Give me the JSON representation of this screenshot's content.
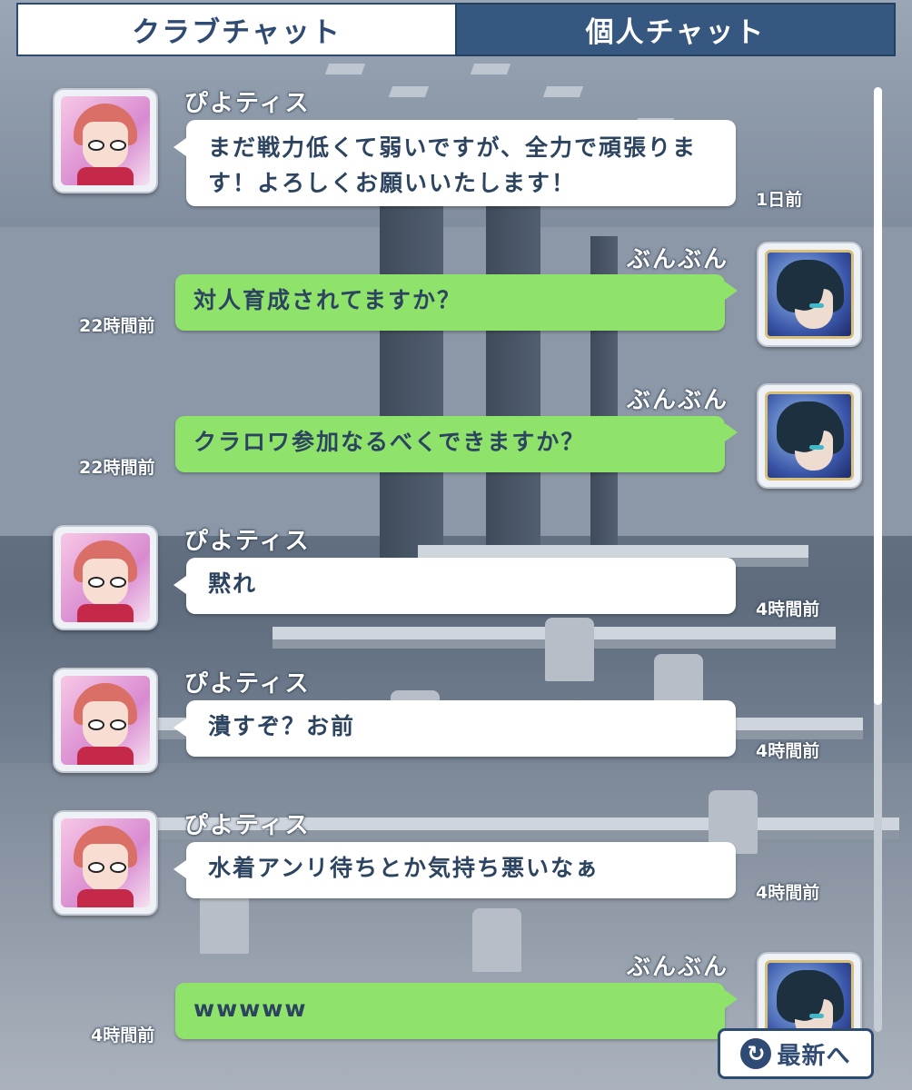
{
  "tabs": [
    {
      "label": "クラブチャット",
      "active": false
    },
    {
      "label": "個人チャット",
      "active": true
    }
  ],
  "messages": [
    {
      "sender": "ぴよティス",
      "text": "まだ戦力低くて弱いですが、全力で頑張ります！よろしくお願いいたします！",
      "time": "1日前",
      "side": "left"
    },
    {
      "sender": "ぶんぶん",
      "text": "対人育成されてますか？",
      "time": "22時間前",
      "side": "right"
    },
    {
      "sender": "ぶんぶん",
      "text": "クラロワ参加なるべくできますか？",
      "time": "22時間前",
      "side": "right"
    },
    {
      "sender": "ぴよティス",
      "text": "黙れ",
      "time": "4時間前",
      "side": "left"
    },
    {
      "sender": "ぴよティス",
      "text": "潰すぞ？お前",
      "time": "4時間前",
      "side": "left"
    },
    {
      "sender": "ぴよティス",
      "text": "水着アンリ待ちとか気持ち悪いなぁ",
      "time": "4時間前",
      "side": "left"
    },
    {
      "sender": "ぶんぶん",
      "text": "wwwww",
      "time": "4時間前",
      "side": "right"
    }
  ],
  "refresh_button": {
    "icon": "refresh-icon",
    "label": "最新へ"
  },
  "colors": {
    "tab_active_bg": "#36577f",
    "tab_inactive_text": "#2f4a73",
    "bubble_other": "#ffffff",
    "bubble_self": "#8fe26a",
    "message_text": "#2d4461"
  }
}
